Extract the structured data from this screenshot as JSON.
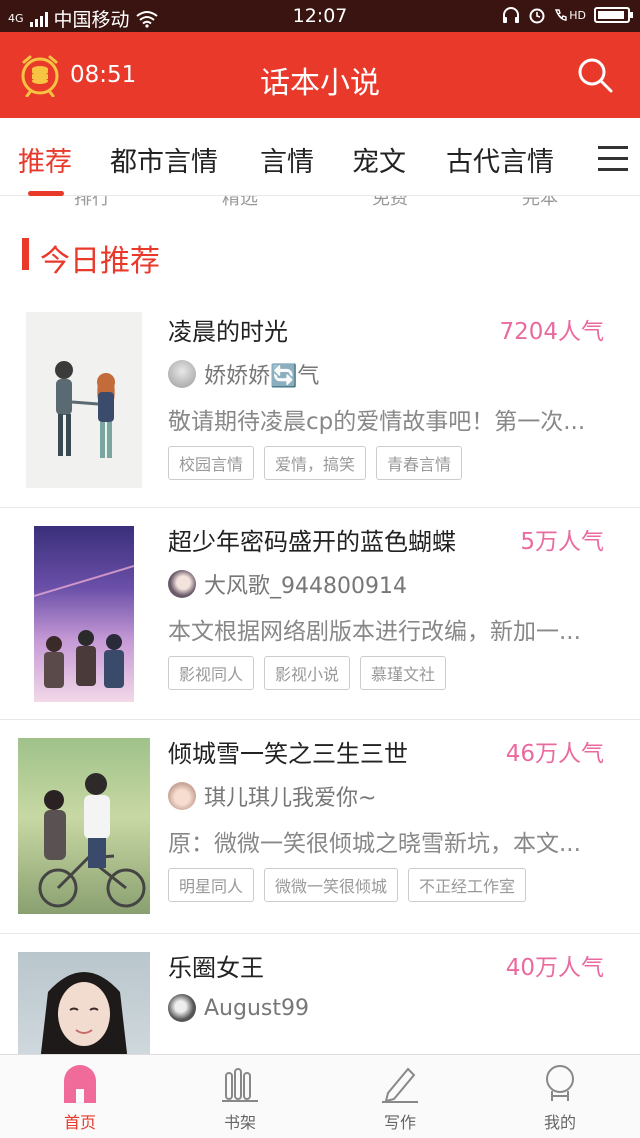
{
  "status_bar": {
    "carrier": "中国移动",
    "network": "4G",
    "time": "12:07",
    "hd_label": "HD"
  },
  "app_bar": {
    "clock_time": "08:51",
    "title": "话本小说"
  },
  "tabs": [
    {
      "label": "推荐",
      "active": true
    },
    {
      "label": "都市言情"
    },
    {
      "label": "言情"
    },
    {
      "label": "宠文"
    },
    {
      "label": "古代言情"
    }
  ],
  "cutoff_labels": [
    "排行",
    "精选",
    "免费",
    "完本"
  ],
  "section": {
    "title": "今日推荐"
  },
  "books": [
    {
      "title": "凌晨的时光",
      "popularity": "7204人气",
      "author": "娇娇娇🔄气",
      "description": "敬请期待凌晨cp的爱情故事吧！第一次...",
      "tags": [
        "校园言情",
        "爱情，搞笑",
        "青春言情"
      ]
    },
    {
      "title": "超少年密码盛开的蓝色蝴蝶",
      "popularity": "5万人气",
      "author": "大风歌_944800914",
      "description": "本文根据网络剧版本进行改编，新加一...",
      "tags": [
        "影视同人",
        "影视小说",
        "慕瑾文社"
      ]
    },
    {
      "title": "倾城雪一笑之三生三世",
      "popularity": "46万人气",
      "author": "琪儿琪儿我爱你~",
      "description": "原：微微一笑很倾城之晓雪新坑，本文...",
      "tags": [
        "明星同人",
        "微微一笑很倾城",
        "不正经工作室"
      ]
    },
    {
      "title": "乐圈女王",
      "popularity": "40万人气",
      "author": "August99",
      "description": "",
      "tags": []
    }
  ],
  "bottom_nav": [
    {
      "label": "首页",
      "icon": "home-icon",
      "active": true
    },
    {
      "label": "书架",
      "icon": "bookshelf-icon"
    },
    {
      "label": "写作",
      "icon": "pen-icon"
    },
    {
      "label": "我的",
      "icon": "profile-icon"
    }
  ],
  "colors": {
    "brand_red": "#e8392b",
    "popularity_pink": "#ea6a9f",
    "status_bar": "#3a1410"
  }
}
